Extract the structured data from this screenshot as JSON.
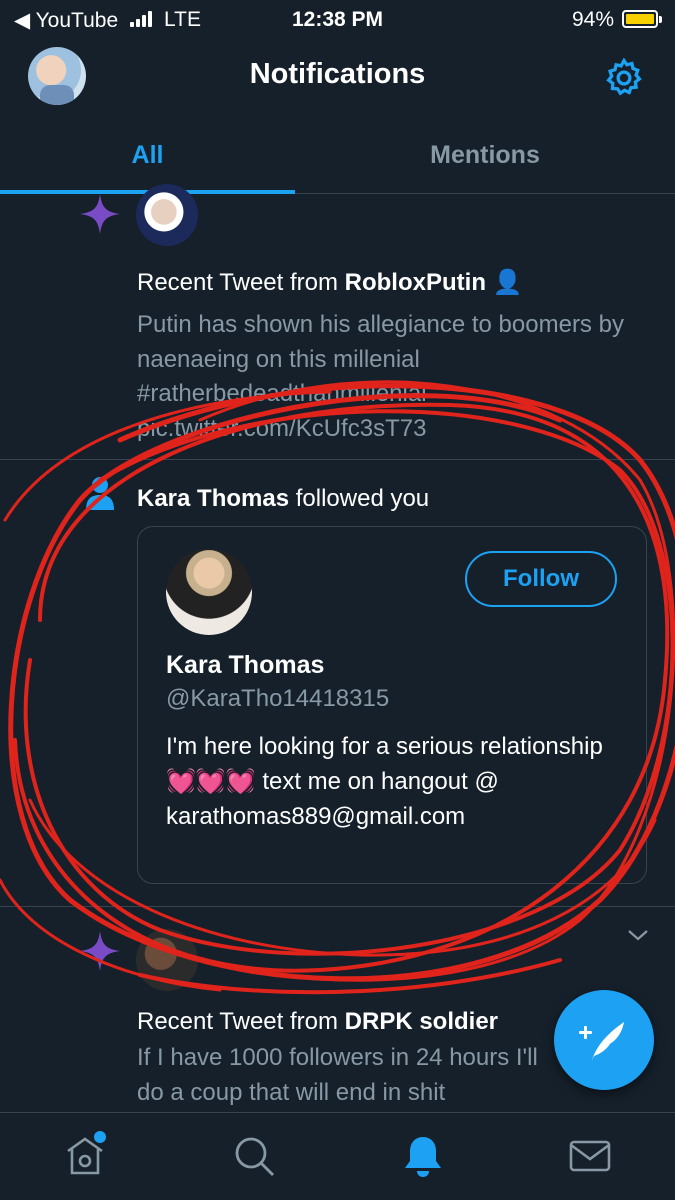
{
  "status_bar": {
    "back_app": "◀ YouTube",
    "network": "LTE",
    "time": "12:38 PM",
    "battery": "94%"
  },
  "header": {
    "title": "Notifications"
  },
  "tabs": [
    {
      "label": "All",
      "active": true
    },
    {
      "label": "Mentions",
      "active": false
    }
  ],
  "notifications": [
    {
      "type": "recent_tweet",
      "prefix": "Recent Tweet from ",
      "user": "RobloxPutin",
      "user_badge": "👤",
      "body": "Putin has shown his allegiance to boomers by naenaeing on this millenial #ratherbedeadthanmillenial pic.twitter.com/KcUfc3sT73"
    },
    {
      "type": "follow",
      "user": "Kara Thomas",
      "suffix": " followed you",
      "card": {
        "name": "Kara Thomas",
        "handle": "@KaraTho14418315",
        "follow_label": "Follow",
        "bio": "I'm here looking for a serious relationship 💓💓💓 text me on hangout @ karathomas889@gmail.com"
      }
    },
    {
      "type": "recent_tweet",
      "prefix": "Recent Tweet from ",
      "user": "DRPK soldier",
      "body": "If I have 1000 followers in 24 hours I'll do a coup that will end in shit"
    }
  ],
  "colors": {
    "background": "#15202b",
    "accent": "#1da1f2",
    "muted": "#8899a6",
    "divider": "#38444d",
    "sparkle": "#794bc4",
    "scribble": "#e0241b"
  },
  "icons": {
    "settings": "gear-icon",
    "compose": "compose-tweet-icon",
    "nav": [
      "home-icon",
      "search-icon",
      "bell-icon",
      "mail-icon"
    ]
  }
}
